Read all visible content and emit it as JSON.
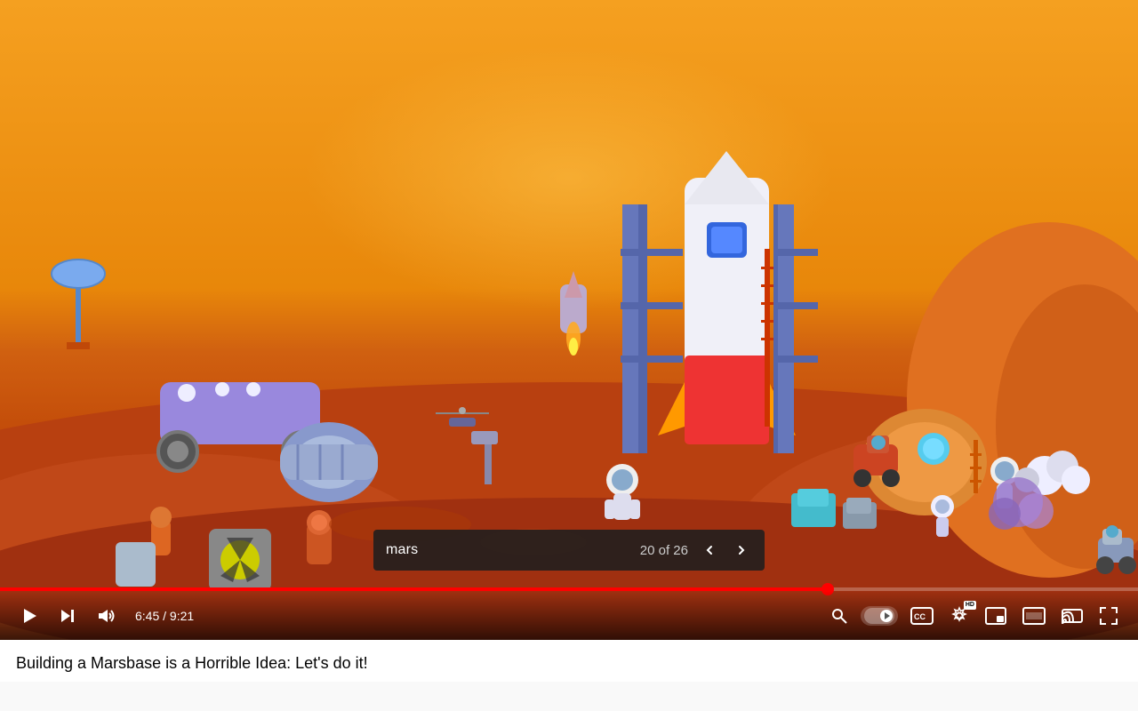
{
  "video": {
    "title": "Building a Marsbase is a Horrible Idea: Let's do it!",
    "current_time": "6:45",
    "total_time": "9:21",
    "progress_percent": 72.7
  },
  "search": {
    "query": "mars",
    "current_match": 20,
    "total_matches": 26,
    "count_label": "20 of 26"
  },
  "controls": {
    "play_label": "Play",
    "next_label": "Next",
    "volume_label": "Volume",
    "search_label": "Search",
    "autoplay_label": "Autoplay",
    "cc_label": "Subtitles",
    "settings_label": "Settings",
    "miniplayer_label": "Miniplayer",
    "theater_label": "Theater mode",
    "cast_label": "Cast",
    "fullscreen_label": "Fullscreen",
    "hd_badge": "HD",
    "prev_match_label": "<",
    "next_match_label": ">"
  }
}
